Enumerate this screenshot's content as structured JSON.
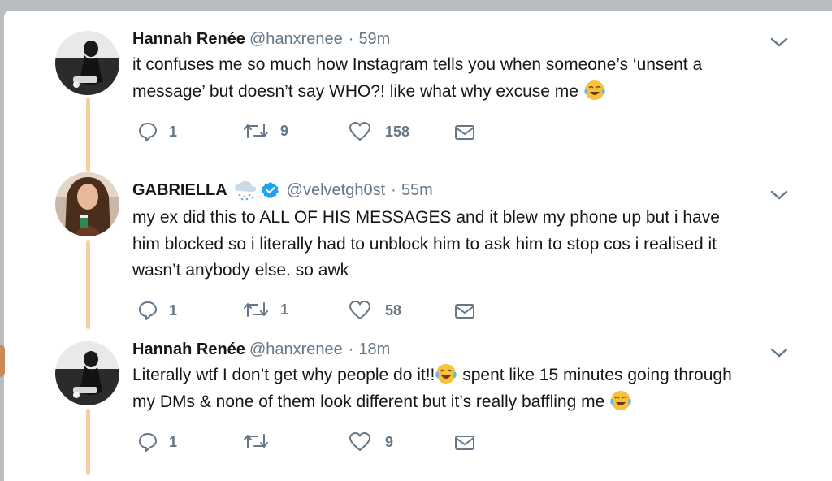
{
  "tweets": [
    {
      "name": "Hannah Renée",
      "handle": "@hanxrenee",
      "separator": "·",
      "time": "59m",
      "text_lines": [
        "it confuses me so much how Instagram tells you when someone’s ‘unsent a",
        "message’ but doesn’t say WHO?! like what why excuse me"
      ],
      "actions": {
        "replies": "1",
        "retweets": "9",
        "likes": "158"
      },
      "avatar": "avatar-photo"
    },
    {
      "name": "GABRIELLA",
      "name_emoji": "snow-cloud-icon",
      "verified": true,
      "handle": "@velvetgh0st",
      "separator": "·",
      "time": "55m",
      "text_lines": [
        "my ex did this to ALL OF HIS MESSAGES and it blew my phone up but i have",
        "him blocked so i literally had to unblock him to ask him to stop cos i realised it",
        "wasn’t anybody else. so awk"
      ],
      "actions": {
        "replies": "1",
        "retweets": "1",
        "likes": "58"
      },
      "avatar": "avatar-photo"
    },
    {
      "name": "Hannah Renée",
      "handle": "@hanxrenee",
      "separator": "·",
      "time": "18m",
      "text_lines": [
        "Literally wtf I don’t get why people do it!!",
        " spent like 15 minutes going through",
        "my DMs & none of them look different but it’s really baffling me"
      ],
      "actions": {
        "replies": "1",
        "retweets": "",
        "likes": "9"
      },
      "avatar": "avatar-photo"
    }
  ],
  "colors": {
    "text": "#14171a",
    "secondary": "#657786",
    "thread_line": "#f5cfa0",
    "verified": "#1da1f2"
  }
}
